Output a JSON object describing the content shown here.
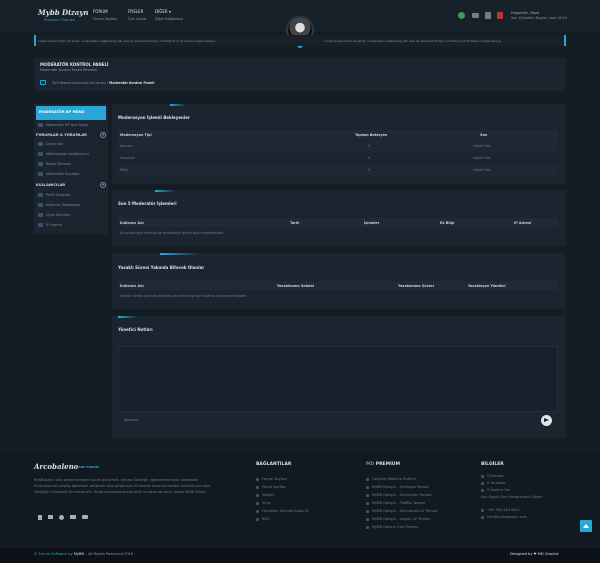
{
  "brand": {
    "logo": "Mybb Dizayn",
    "sub": "Premium Themes"
  },
  "nav": [
    {
      "label": "FORUM",
      "sub": "Forum Sayfası"
    },
    {
      "label": "ÜYELER",
      "sub": "Üye Listesi"
    },
    {
      "label": "DİĞER",
      "sub": "Diğer Bağlantılar"
    }
  ],
  "user": {
    "greet": "Hoşgeldin, Mbyb",
    "last": "Son Ziyaretin: Bugün, saat 18:54"
  },
  "notice": {
    "left": "Lorem ipsum dolor sit amet, consectetur adipisicing elit, sed do eiusmod tempor incididunt ut et dolore magna aliqua.",
    "right": "Lorem ipsum dolor sit amet, consectetur adipisicing elit, sed do eiusmod tempor incididunt ut et dolore magna aliqua."
  },
  "modpanel": {
    "title": "MODERATÖR KONTROL PANELİ",
    "subtitle": "Moderatör Kontrol Paneli Yönetimi",
    "crumb_home": "Türk eksmet kullanıcılık forum sisi",
    "crumb_current": "Moderatör Kontrol Paneli"
  },
  "sidebar": {
    "menu_title": "MODERATÖR KP MENÜ",
    "menu_home": "Moderatör KP Ana Sayfa",
    "forums_title": "FORUMLAR & YORUMLAR",
    "forums": [
      "Duyurular",
      "Moderasyon Kalitesyonu",
      "Rapor Merkezi",
      "Moderatör Kayıtları"
    ],
    "users_title": "KULLANICILAR",
    "users": [
      "Profil Düzenle",
      "Kullanıcı Yasaklama",
      "Uyarı Kayıtları",
      "IP Arama"
    ]
  },
  "section1": {
    "title": "Moderasyon İşlemli Bekleyenler",
    "headers": [
      "Moderasyon Tipi",
      "Toplam Bekleyen",
      "Son"
    ],
    "rows": [
      [
        "Konular",
        "0",
        "Hiçbiri Yok"
      ],
      [
        "Yorumlar",
        "0",
        "Hiçbiri Yok"
      ],
      [
        "Ekler",
        "0",
        "Hiçbiri Yok"
      ]
    ]
  },
  "section2": {
    "title": "Son 5 Moderatör İşlemleri",
    "headers": [
      "Kullanıcı Adı",
      "Tarih",
      "İşlemler",
      "Ek Bilgi",
      "IP Adresi"
    ],
    "empty": "Şu anda kayıt edilmiş bir moderatör işlemi bulunmamaktadır."
  },
  "section3": {
    "title": "Yasaklı Süresi Yakında Bitecek Olanlar",
    "headers": [
      "Kullanıcı Adı",
      "Yasaklanma Sebebi",
      "Yasaklanma Süresi",
      "Yasaklayan Yönetici"
    ],
    "empty": "Yasaklı süresi yakında bitecek olan herhangi bir kullanıcı bulunmamaktadır."
  },
  "section4": {
    "title": "Yönetici Notları",
    "placeholder": "Notunuz"
  },
  "footer": {
    "logo": "Arcobaleno",
    "logo_sub": "DARK FORUM",
    "about": "MyBB Dizayn olan sevide temaların soneti gelişirmek, herkesi tüzdeliğe, oğrenimelere aracı olmaktadır. Kullanıcıyla son paylaşı öğrenmek, gelişimek veya geliştirmek ile tasımak amacıyla hareket ederlerle pet sofra. Sahipliğin hürmetiyle bir hermariyla. Mysbs hesaplamınla size birlik ve varsa pet sofra. Sosyal MyBB Dizayn.",
    "links_title": "BAĞLANTILAR",
    "links": [
      "Forum Sayfası",
      "Portal Sayfası",
      "İletişim",
      "Arşiv",
      "Forumları Okundu Kabul Et",
      "RSS"
    ],
    "premium_title_a": "MD",
    "premium_title_b": "PREMIUM",
    "premium": [
      "Gelişmiş Mobilite Sistemi",
      "MyBB Dizaynı – Simbiyoz Teması",
      "MyBB Dizaynı – Dimension Teması",
      "MyBB Dizaynı – FlatBlu Teması",
      "MyBB Dizaynı – Soundcraft v2 Teması",
      "MyBB Dizaynı – Legion v2 Teması",
      "MyBB Dizaynı Özel Teması"
    ],
    "info_title": "BİLGİLER",
    "info": [
      "0 Konular",
      "0 Yorumlar",
      "0 Üyemiz Var",
      "Son Kayıtlı Son Mesajlarınızı Göster"
    ],
    "phone": "+90 555 444 6611",
    "email": "info@mybbdizayn.com",
    "copyright_a": "© Forum Software by",
    "copyright_b": "MyBB",
    "copyright_c": "– All Rights Reserved 2019",
    "designed": "Designed by ❤ MD Graphic"
  },
  "colors": {
    "accent": "#29a7d6",
    "bg": "#141c24",
    "panel": "#1b2530"
  }
}
